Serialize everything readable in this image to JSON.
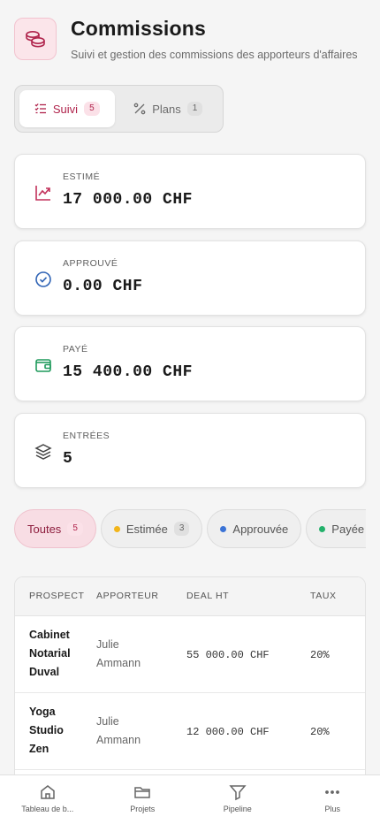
{
  "header": {
    "title": "Commissions",
    "subtitle": "Suivi et gestion des commissions des apporteurs d'affaires",
    "icon": "coins-icon"
  },
  "tabs": [
    {
      "label": "Suivi",
      "count": "5",
      "active": true,
      "icon": "checklist-icon"
    },
    {
      "label": "Plans",
      "count": "1",
      "active": false,
      "icon": "percent-icon"
    }
  ],
  "stats": [
    {
      "label": "ESTIMÉ",
      "value": "17 000.00 CHF",
      "icon": "trend-up-icon",
      "color": "#c2305a"
    },
    {
      "label": "APPROUVÉ",
      "value": "0.00 CHF",
      "icon": "check-circle-icon",
      "color": "#2f63b5"
    },
    {
      "label": "PAYÉ",
      "value": "15 400.00 CHF",
      "icon": "wallet-icon",
      "color": "#1f9a5c"
    },
    {
      "label": "ENTRÉES",
      "value": "5",
      "icon": "layers-icon",
      "color": "#444444"
    }
  ],
  "filters": [
    {
      "label": "Toutes",
      "count": "5",
      "active": true
    },
    {
      "label": "Estimée",
      "count": "3",
      "dot_color": "#f2b51a"
    },
    {
      "label": "Approuvée",
      "dot_color": "#3b73d6"
    },
    {
      "label": "Payée",
      "dot_color": "#23b16b"
    }
  ],
  "table": {
    "headers": [
      "PROSPECT",
      "APPORTEUR",
      "DEAL HT",
      "TAUX"
    ],
    "rows": [
      {
        "prospect": [
          "Cabinet",
          "Notarial",
          "Duval"
        ],
        "apporteur": [
          "Julie",
          "Ammann"
        ],
        "deal": "55 000.00 CHF",
        "taux": "20%"
      },
      {
        "prospect": [
          "Yoga",
          "Studio",
          "Zen"
        ],
        "apporteur": [
          "Julie",
          "Ammann"
        ],
        "deal": "12 000.00 CHF",
        "taux": "20%"
      }
    ]
  },
  "nav": [
    {
      "label": "Tableau de b...",
      "icon": "home-icon"
    },
    {
      "label": "Projets",
      "icon": "folder-icon"
    },
    {
      "label": "Pipeline",
      "icon": "filter-icon"
    },
    {
      "label": "Plus",
      "icon": "more-icon"
    }
  ]
}
